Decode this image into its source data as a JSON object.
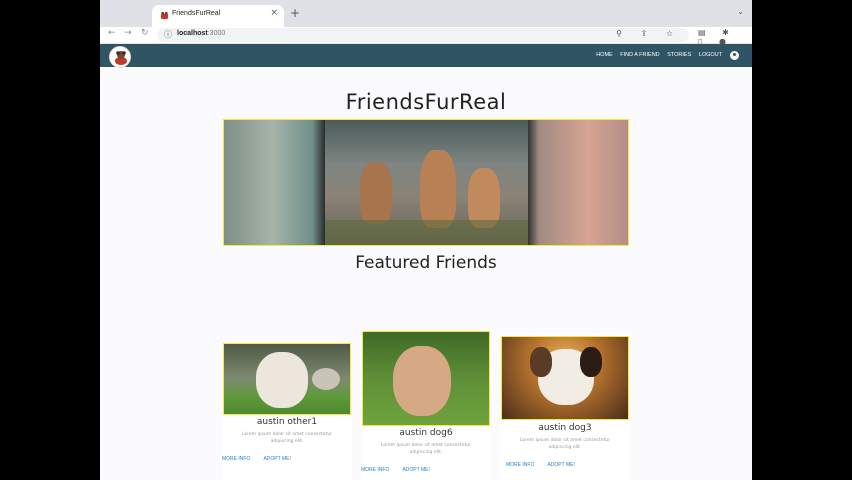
{
  "browser": {
    "tab_title": "FriendsFurReal",
    "tab_close": "×",
    "new_tab": "+",
    "tab_menu": "⌄",
    "back": "←",
    "forward": "→",
    "reload": "↻",
    "info_icon": "ⓘ",
    "url_host": "localhost",
    "url_port": ":3000",
    "omni_icons": "⚲ ⇪ ☆",
    "toolbar_icons": "▤ ✱ ▯ ● ⋮"
  },
  "nav": {
    "links": [
      "HOME",
      "FIND A FRIEND",
      "STORIES",
      "LOGOUT"
    ]
  },
  "page": {
    "title": "FriendsFurReal",
    "featured_heading": "Featured Friends"
  },
  "cards": [
    {
      "name": "austin other1",
      "desc": "Lorem ipsum dolor sit amet consectetur adipiscing elit.",
      "more": "MORE INFO",
      "adopt": "ADOPT ME!"
    },
    {
      "name": "austin dog6",
      "desc": "Lorem ipsum dolor sit amet consectetur adipiscing elit.",
      "more": "MORE INFO",
      "adopt": "ADOPT ME!"
    },
    {
      "name": "austin dog3",
      "desc": "Lorem ipsum dolor sit amet consectetur adipiscing elit.",
      "more": "MORE INFO",
      "adopt": "ADOPT ME!"
    }
  ],
  "colors": {
    "navbar": "#2f5565",
    "accent_border": "#f0ec3c",
    "link": "#2a7fc6"
  }
}
